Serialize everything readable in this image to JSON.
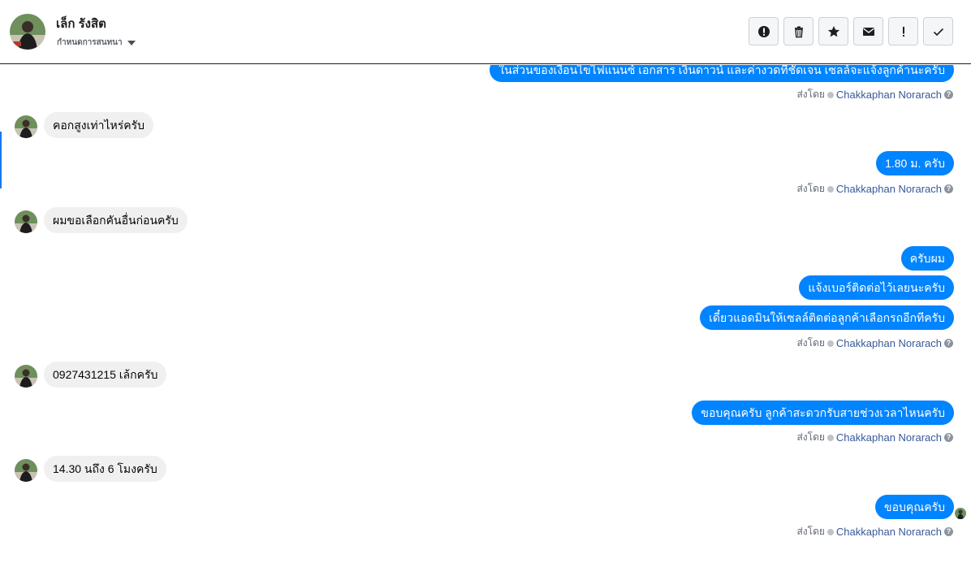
{
  "header": {
    "name": "เล็ก รังสิต",
    "subtitle": "กำหนดการสนทนา",
    "actions": [
      {
        "icon": "alert-circle-icon"
      },
      {
        "icon": "trash-icon"
      },
      {
        "icon": "star-icon"
      },
      {
        "icon": "envelope-icon"
      },
      {
        "icon": "exclamation-icon"
      },
      {
        "icon": "check-icon"
      }
    ]
  },
  "thread": {
    "sent_by_prefix": "ส่งโดย",
    "agent_name": "Chakkaphan Norarach",
    "messages": [
      {
        "id": "m0",
        "from": "page",
        "text": "ในส่วนของเงื่อนไขไฟแนนซ์ เอกสาร เงินดาวน์ และค่างวดที่ชัดเจน เซลล์จะแจ้งลูกค้านะครับ"
      },
      {
        "id": "m1",
        "from": "customer",
        "text": "คอกสูงเท่าไหร่ครับ"
      },
      {
        "id": "m2",
        "from": "page",
        "text": "1.80 ม. ครับ"
      },
      {
        "id": "m3",
        "from": "customer",
        "text": "ผมขอเลือกคันอื่นก่อนครับ"
      },
      {
        "id": "m4",
        "from": "page",
        "text": "ครับผม"
      },
      {
        "id": "m5",
        "from": "page",
        "text": "แจ้งเบอร์ติดต่อไว้เลยนะครับ"
      },
      {
        "id": "m6",
        "from": "page",
        "text": "เดี๋ยวแอดมินให้เซลล์ติดต่อลูกค้าเลือกรถอีกทีครับ"
      },
      {
        "id": "m7",
        "from": "customer",
        "text": "0927431215 เล้กครับ"
      },
      {
        "id": "m8",
        "from": "page",
        "text": "ขอบคุณครับ ลูกค้าสะดวกรับสายช่วงเวลาไหนครับ"
      },
      {
        "id": "m9",
        "from": "customer",
        "text": "14.30 นถึง 6 โมงครับ"
      },
      {
        "id": "m10",
        "from": "page",
        "text": "ขอบคุณครับ"
      }
    ]
  },
  "colors": {
    "outgoing_bubble": "#0084ff",
    "incoming_bubble": "#f0f0f0",
    "agent_link": "#385898"
  }
}
